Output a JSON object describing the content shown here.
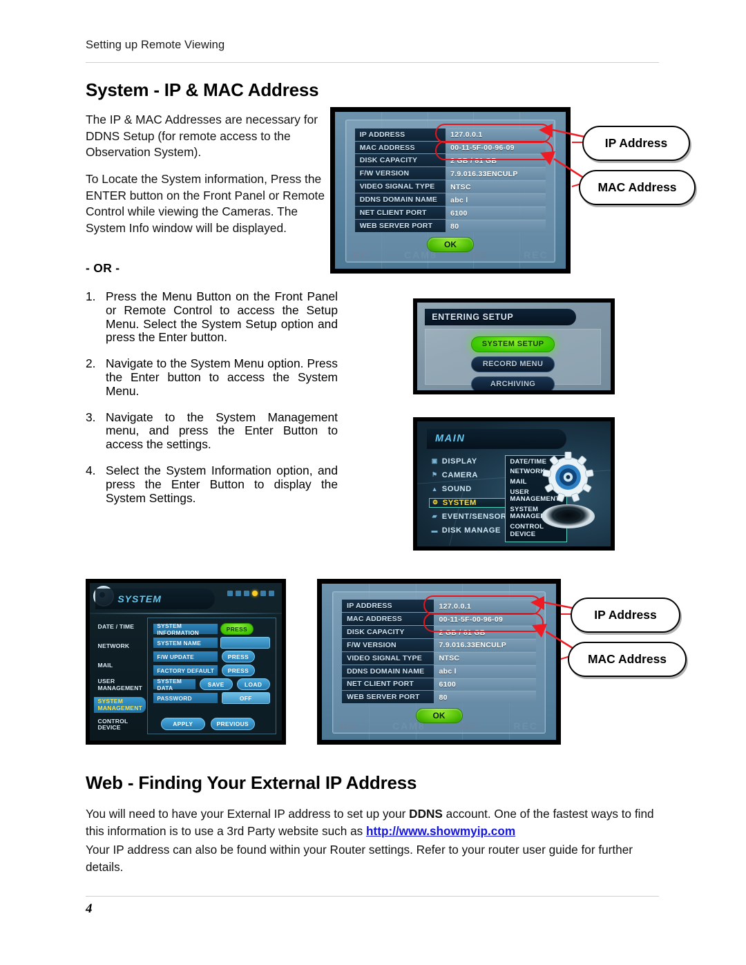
{
  "header": {
    "running_head": "Setting up Remote Viewing"
  },
  "sections": {
    "system": {
      "heading": "System - IP & MAC Address",
      "intro": "The IP & MAC Addresses are necessary for DDNS Setup (for remote access to the Observation System).",
      "locate": "To Locate the System information, Press the ENTER button on the Front Panel or Remote Control while viewing the Cameras. The System Info window will be displayed.",
      "or_label": "- OR -",
      "steps": [
        {
          "num": "1.",
          "text": "Press the Menu Button on the Front Panel or Remote Control to access the Setup Menu. Select the System Setup option and press the Enter button."
        },
        {
          "num": "2.",
          "text": "Navigate to the System Menu option. Press the Enter button to access the System Menu."
        },
        {
          "num": "3.",
          "text": "Navigate to the System Management menu, and press the Enter Button to access the settings."
        },
        {
          "num": "4.",
          "text": "Select the System Information option, and press the Enter Button to display the System Settings."
        }
      ]
    },
    "web": {
      "heading": "Web - Finding Your External IP Address",
      "para1_a": "You will need to have your External IP address to set up your ",
      "para1_bold": "DDNS",
      "para1_b": " account. One of the fastest ways to find this information is to use a 3rd Party website such as ",
      "para1_link": "http://www.showmyip.com",
      "para2": "Your IP address can also be found within your Router settings. Refer to your router user guide for further details."
    }
  },
  "system_info_dialog": {
    "rows": [
      {
        "label": "IP ADDRESS",
        "value": "127.0.0.1"
      },
      {
        "label": "MAC ADDRESS",
        "value": "00-11-5F-00-96-09"
      },
      {
        "label": "DISK CAPACITY",
        "value": "2 GB  /  81  GB"
      },
      {
        "label": "F/W VERSION",
        "value": "7.9.016.33ENCULP"
      },
      {
        "label": "VIDEO SIGNAL TYPE",
        "value": "NTSC"
      },
      {
        "label": "DDNS DOMAIN NAME",
        "value": "abc l"
      },
      {
        "label": "NET CLIENT PORT",
        "value": "6100"
      },
      {
        "label": "WEB SERVER PORT",
        "value": "80"
      }
    ],
    "ok_label": "OK",
    "background_text": [
      "RC",
      "CAM8",
      "RC",
      "REC"
    ]
  },
  "callouts": {
    "ip": "IP Address",
    "mac": "MAC Address"
  },
  "entering_setup": {
    "title": "ENTERING SETUP",
    "buttons": [
      {
        "label": "SYSTEM SETUP",
        "selected": true
      },
      {
        "label": "RECORD MENU",
        "selected": false
      },
      {
        "label": "ARCHIVING",
        "selected": false
      }
    ]
  },
  "main_menu": {
    "title": "MAIN",
    "nav": [
      {
        "label": "DISPLAY",
        "icon": "monitor-icon",
        "glyph": "▣",
        "selected": false
      },
      {
        "label": "CAMERA",
        "icon": "camera-icon",
        "glyph": "⚑",
        "selected": false
      },
      {
        "label": "SOUND",
        "icon": "speaker-icon",
        "glyph": "▲",
        "selected": false
      },
      {
        "label": "SYSTEM",
        "icon": "gear-icon",
        "glyph": "⚙",
        "selected": true
      },
      {
        "label": "EVENT/SENSOR",
        "icon": "sensor-icon",
        "glyph": "▰",
        "selected": false
      },
      {
        "label": "DISK MANAGE",
        "icon": "disk-icon",
        "glyph": "▬",
        "selected": false
      }
    ],
    "submenu": [
      "DATE/TIME",
      "NETWORK",
      "MAIL",
      "USER MANAGEMENT",
      "SYSTEM MANAGEMENT",
      "CONTROL DEVICE"
    ]
  },
  "system_panel": {
    "title": "SYSTEM",
    "tabs": [
      {
        "label": "DATE / TIME",
        "selected": false
      },
      {
        "label": "NETWORK",
        "selected": false
      },
      {
        "label": "MAIL",
        "selected": false
      },
      {
        "label": "USER MANAGEMENT",
        "selected": false
      },
      {
        "label": "SYSTEM MANAGEMENT",
        "selected": true
      },
      {
        "label": "CONTROL DEVICE",
        "selected": false
      }
    ],
    "fields": [
      {
        "name": "SYSTEM INFORMATION",
        "buttons": [
          {
            "label": "PRESS",
            "style": "green"
          }
        ]
      },
      {
        "name": "SYSTEM NAME",
        "buttons": [
          {
            "label": "",
            "style": "blank"
          }
        ]
      },
      {
        "name": "F/W UPDATE",
        "buttons": [
          {
            "label": "PRESS",
            "style": "blue"
          }
        ]
      },
      {
        "name": "FACTORY DEFAULT",
        "buttons": [
          {
            "label": "PRESS",
            "style": "blue"
          }
        ]
      },
      {
        "name": "SYSTEM DATA",
        "buttons": [
          {
            "label": "SAVE",
            "style": "blue"
          },
          {
            "label": "LOAD",
            "style": "blue"
          }
        ]
      },
      {
        "name": "PASSWORD",
        "buttons": [
          {
            "label": "OFF",
            "style": "off"
          }
        ]
      }
    ],
    "bottom_buttons": [
      "APPLY",
      "PREVIOUS"
    ]
  },
  "footer": {
    "page_number": "4"
  }
}
